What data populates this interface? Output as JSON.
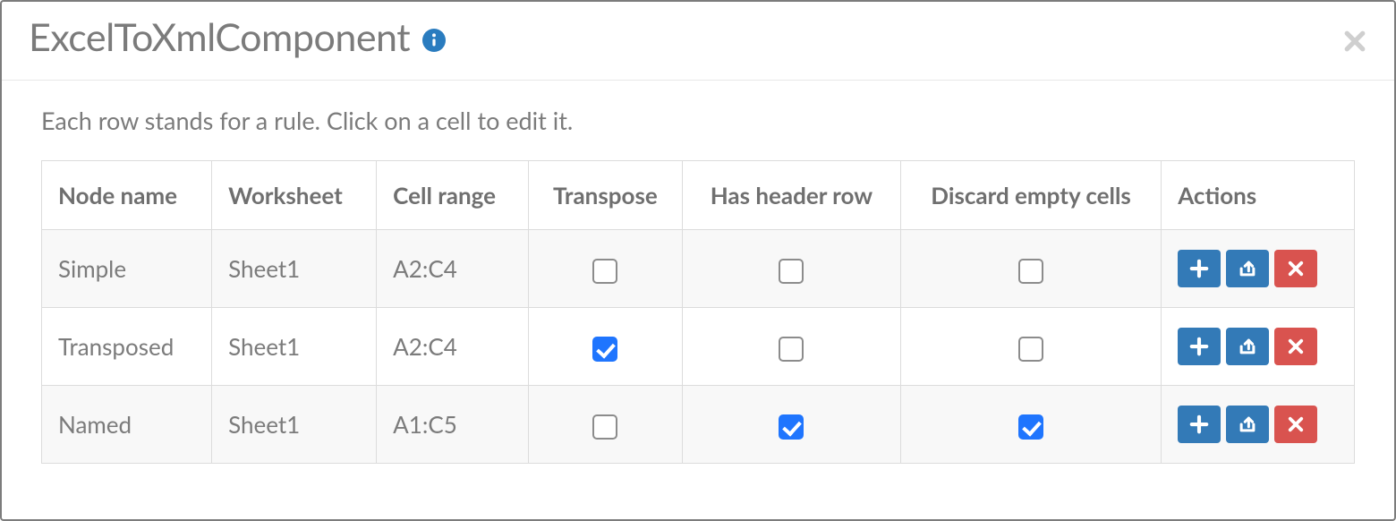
{
  "header": {
    "title": "ExcelToXmlComponent"
  },
  "instructions": "Each row stands for a rule. Click on a cell to edit it.",
  "columns": {
    "node_name": "Node name",
    "worksheet": "Worksheet",
    "cell_range": "Cell range",
    "transpose": "Transpose",
    "has_header_row": "Has header row",
    "discard_empty_cells": "Discard empty cells",
    "actions": "Actions"
  },
  "rows": [
    {
      "node_name": "Simple",
      "worksheet": "Sheet1",
      "cell_range": "A2:C4",
      "transpose": false,
      "has_header_row": false,
      "discard_empty_cells": false
    },
    {
      "node_name": "Transposed",
      "worksheet": "Sheet1",
      "cell_range": "A2:C4",
      "transpose": true,
      "has_header_row": false,
      "discard_empty_cells": false
    },
    {
      "node_name": "Named",
      "worksheet": "Sheet1",
      "cell_range": "A1:C5",
      "transpose": false,
      "has_header_row": true,
      "discard_empty_cells": true
    }
  ],
  "colors": {
    "primary_button": "#337ab7",
    "danger_button": "#d9534f",
    "checked_checkbox": "#1f75fe"
  }
}
